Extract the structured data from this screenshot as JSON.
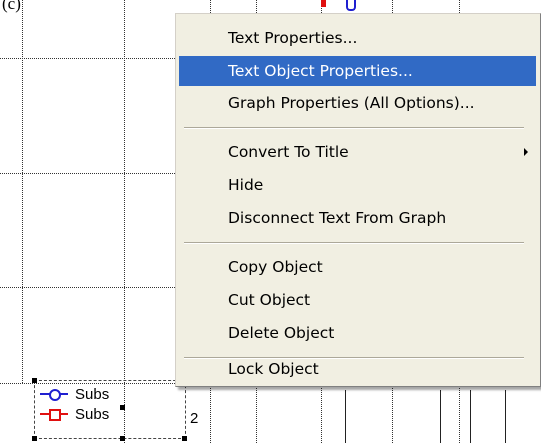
{
  "top_text": "(c)",
  "menu": {
    "items": [
      {
        "label": "Text Properties...",
        "selected": false
      },
      {
        "label": "Text Object Properties...",
        "selected": true
      },
      {
        "label": "Graph Properties (All Options)...",
        "selected": false
      },
      {
        "label": "Convert To Title",
        "selected": false,
        "submenu": true
      },
      {
        "label": "Hide",
        "selected": false
      },
      {
        "label": "Disconnect Text From Graph",
        "selected": false
      },
      {
        "label": "Copy Object",
        "selected": false
      },
      {
        "label": "Cut Object",
        "selected": false
      },
      {
        "label": "Delete Object",
        "selected": false
      },
      {
        "label": "Lock Object",
        "selected": false
      }
    ]
  },
  "legend": {
    "entries": [
      {
        "label": "Subs",
        "color": "#1f1fd0",
        "marker": "circle"
      },
      {
        "label": "Subs",
        "color": "#e01010",
        "marker": "square"
      }
    ],
    "trailing_value": "2"
  },
  "colors": {
    "menu_bg": "#f1efe2",
    "highlight": "#316ac5",
    "series_blue": "#1f1fd0",
    "series_red": "#e01010"
  }
}
